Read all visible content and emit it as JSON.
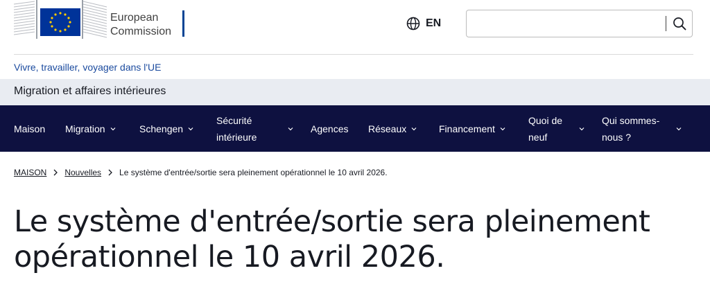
{
  "header": {
    "brand_line1": "European",
    "brand_line2": "Commission",
    "language": "EN",
    "search": {
      "value": "",
      "placeholder": ""
    },
    "icons": {
      "language": "globe-icon",
      "search": "search-icon"
    },
    "colors": {
      "brand_bar": "#004494",
      "flag_blue": "#003399",
      "flag_star": "#ffcc00"
    }
  },
  "tagline": "Vivre, travailler, voyager dans l'UE",
  "site_name": "Migration et affaires intérieures",
  "nav": {
    "background": "#0e1140",
    "items": [
      {
        "label": "Maison",
        "has_dropdown": false
      },
      {
        "label": "Migration",
        "has_dropdown": true
      },
      {
        "label": "Schengen",
        "has_dropdown": true
      },
      {
        "label_line1": "Sécurité",
        "label_line2": "intérieure",
        "has_dropdown": true
      },
      {
        "label": "Agences",
        "has_dropdown": false
      },
      {
        "label": "Réseaux",
        "has_dropdown": true
      },
      {
        "label": "Financement",
        "has_dropdown": true
      },
      {
        "label_line1": "Quoi de",
        "label_line2": "neuf",
        "has_dropdown": true
      },
      {
        "label_line1": "Qui sommes-",
        "label_line2": "nous ?",
        "has_dropdown": true
      }
    ]
  },
  "breadcrumb": {
    "items": [
      "MAISON",
      "Nouvelles"
    ],
    "current": "Le système d'entrée/sortie sera pleinement opérationnel le 10 avril 2026."
  },
  "page": {
    "title_line1": "Le système d'entrée/sortie sera pleinement",
    "title_line2": "opérationnel le 10 avril 2026."
  }
}
